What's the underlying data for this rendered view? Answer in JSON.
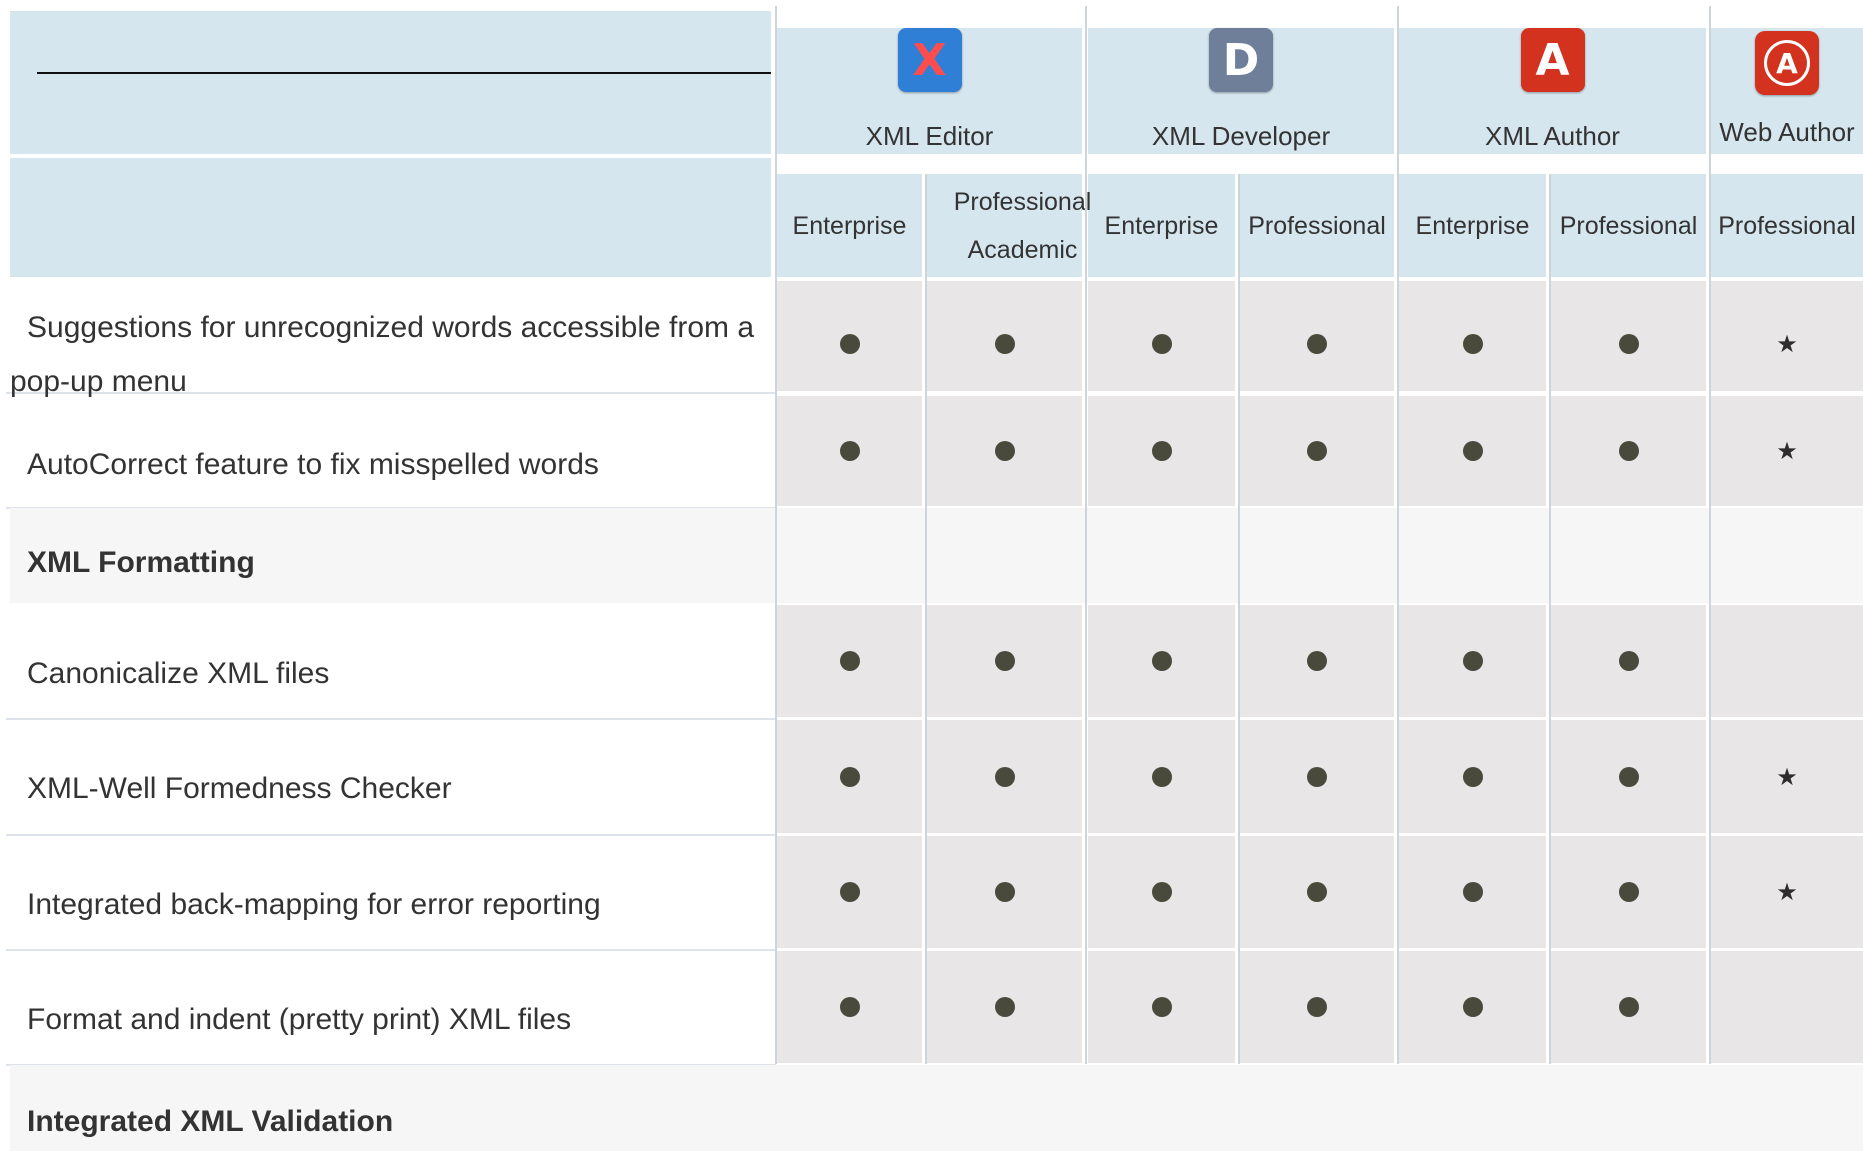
{
  "products": [
    {
      "name": "XML Editor",
      "icon": "xml-editor-logo-icon",
      "glyph": "X",
      "color": "#2f7fd6"
    },
    {
      "name": "XML Developer",
      "icon": "xml-developer-logo-icon",
      "glyph": "D",
      "color": "#6f7f99"
    },
    {
      "name": "XML Author",
      "icon": "xml-author-logo-icon",
      "glyph": "A",
      "color": "#d2321e"
    },
    {
      "name": "Web Author",
      "icon": "web-author-logo-icon",
      "glyph": "A",
      "color": "#d2321e"
    }
  ],
  "editions": [
    "Enterprise",
    "Professional Academic",
    "Enterprise",
    "Professional",
    "Enterprise",
    "Professional",
    "Professional"
  ],
  "rows": [
    {
      "type": "feature",
      "label": "Suggestions for unrecognized words accessible from a pop-up menu",
      "marks": [
        "dot",
        "dot",
        "dot",
        "dot",
        "dot",
        "dot",
        "star"
      ]
    },
    {
      "type": "feature",
      "label": "AutoCorrect feature to fix misspelled words",
      "marks": [
        "dot",
        "dot",
        "dot",
        "dot",
        "dot",
        "dot",
        "star"
      ]
    },
    {
      "type": "section",
      "label": "XML Formatting"
    },
    {
      "type": "feature",
      "label": "Canonicalize XML files",
      "marks": [
        "dot",
        "dot",
        "dot",
        "dot",
        "dot",
        "dot",
        ""
      ]
    },
    {
      "type": "feature",
      "label": "XML-Well Formedness Checker",
      "marks": [
        "dot",
        "dot",
        "dot",
        "dot",
        "dot",
        "dot",
        "star"
      ]
    },
    {
      "type": "feature",
      "label": "Integrated back-mapping for error reporting",
      "marks": [
        "dot",
        "dot",
        "dot",
        "dot",
        "dot",
        "dot",
        "star"
      ]
    },
    {
      "type": "feature",
      "label": "Format and indent (pretty print) XML files",
      "marks": [
        "dot",
        "dot",
        "dot",
        "dot",
        "dot",
        "dot",
        ""
      ]
    },
    {
      "type": "section",
      "label": "Integrated XML Validation"
    }
  ]
}
